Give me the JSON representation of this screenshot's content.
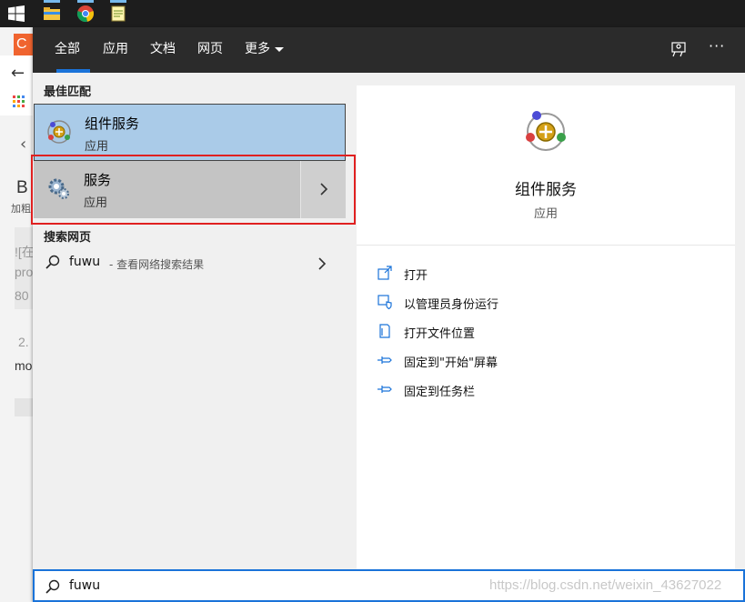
{
  "taskbar": {
    "icons": [
      "windows-start-icon",
      "file-explorer-icon",
      "chrome-icon",
      "notepad-icon"
    ]
  },
  "background_page": {
    "badge": "C",
    "bold_label": "B",
    "bold_caption": "加粗",
    "text_lines": [
      "![在",
      "pro",
      "80",
      "2.",
      "mo"
    ]
  },
  "tabs": [
    {
      "label": "全部",
      "active": true
    },
    {
      "label": "应用"
    },
    {
      "label": "文档"
    },
    {
      "label": "网页"
    },
    {
      "label": "更多"
    }
  ],
  "header_actions": {
    "more": "···"
  },
  "left": {
    "best_match_heading": "最佳匹配",
    "best_match": {
      "name": "组件服务",
      "type": "应用"
    },
    "second_result": {
      "name": "服务",
      "type": "应用"
    },
    "web_heading": "搜索网页",
    "web_result": {
      "query": "fuwu",
      "suffix": "- 查看网络搜索结果"
    }
  },
  "right": {
    "app_name": "组件服务",
    "app_type": "应用",
    "actions": [
      {
        "label": "打开",
        "icon": "open-icon"
      },
      {
        "label": "以管理员身份运行",
        "icon": "shield-run-icon"
      },
      {
        "label": "打开文件位置",
        "icon": "file-location-icon"
      },
      {
        "label": "固定到\"开始\"屏幕",
        "icon": "pin-icon"
      },
      {
        "label": "固定到任务栏",
        "icon": "pin-icon"
      }
    ]
  },
  "search": {
    "value": "fuwu"
  },
  "watermark": "https://blog.csdn.net/weixin_43627022",
  "colors": {
    "accent": "#1a73d9",
    "selected_result": "#aacbe8",
    "hover_result": "#c4c4c4",
    "highlight_box": "#e02020",
    "tabbar": "#2b2b2b"
  }
}
